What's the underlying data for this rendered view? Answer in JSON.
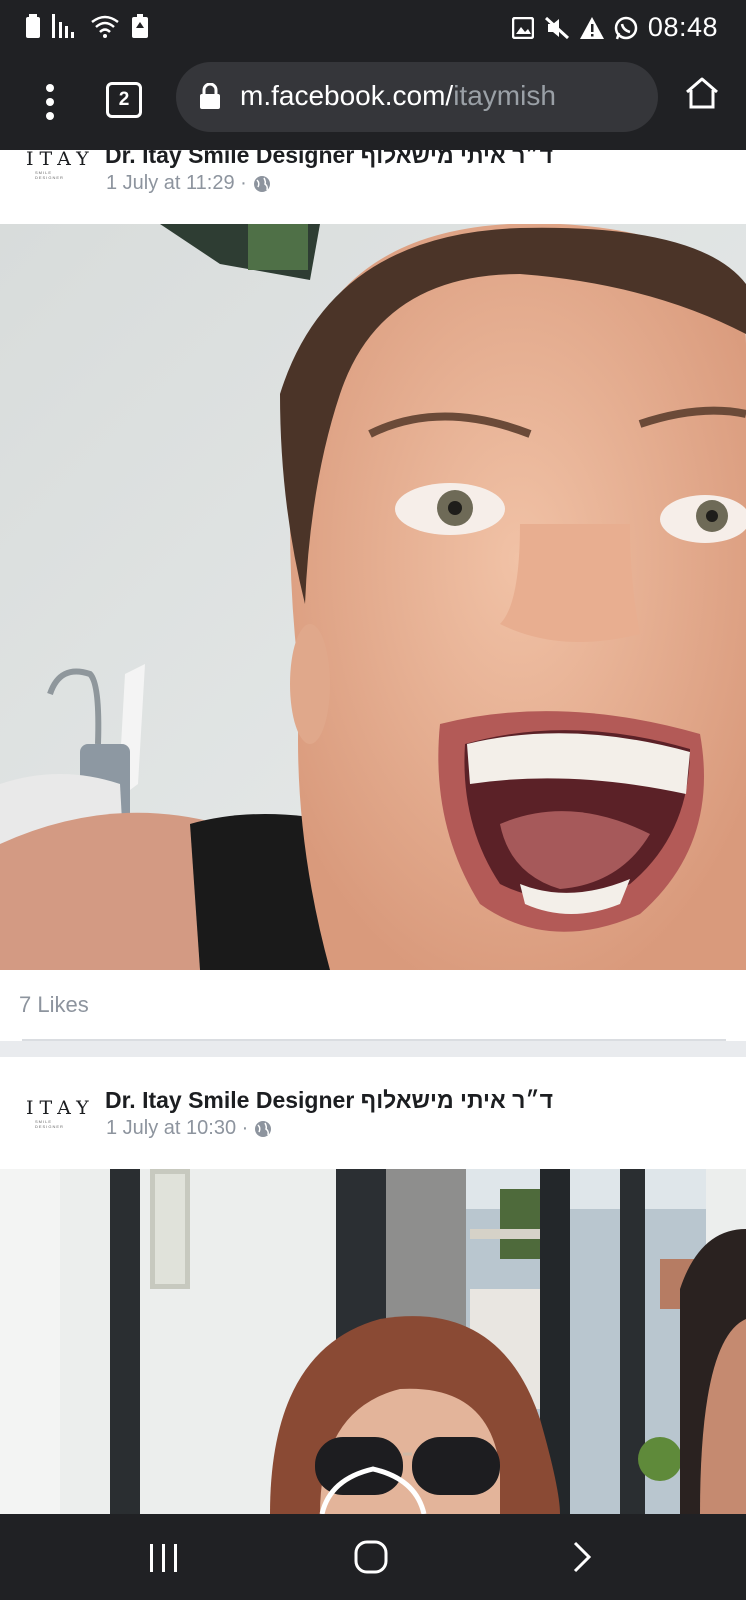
{
  "status_bar": {
    "time": "08:48",
    "icons": [
      "battery-icon",
      "signal-icon",
      "wifi-icon",
      "battery-saver-icon",
      "image-icon",
      "mute-icon",
      "warning-icon",
      "whatsapp-icon"
    ]
  },
  "browser": {
    "tab_count": "2",
    "url_domain": "m.facebook.com/",
    "url_path": "itaymish"
  },
  "posts": [
    {
      "logo_text": "ITAY",
      "logo_subtitle": "SMILE DESIGNER",
      "page_name": "Dr. Itay Smile Designer ד״ר איתי מישאלוף",
      "timestamp": "1 July at 11:29 ·",
      "likes": "7 Likes"
    },
    {
      "logo_text": "ITAY",
      "logo_subtitle": "SMILE DESIGNER",
      "page_name": "Dr. Itay Smile Designer ד״ר איתי מישאלוף",
      "timestamp": "1 July at 10:30 ·"
    }
  ],
  "colors": {
    "chrome_dark": "#202124",
    "url_bar": "#35363a",
    "meta_text": "#8d949e",
    "separator": "#e9ebee"
  },
  "nav": {
    "icons": [
      "recents-icon",
      "home-icon",
      "forward-icon"
    ]
  }
}
